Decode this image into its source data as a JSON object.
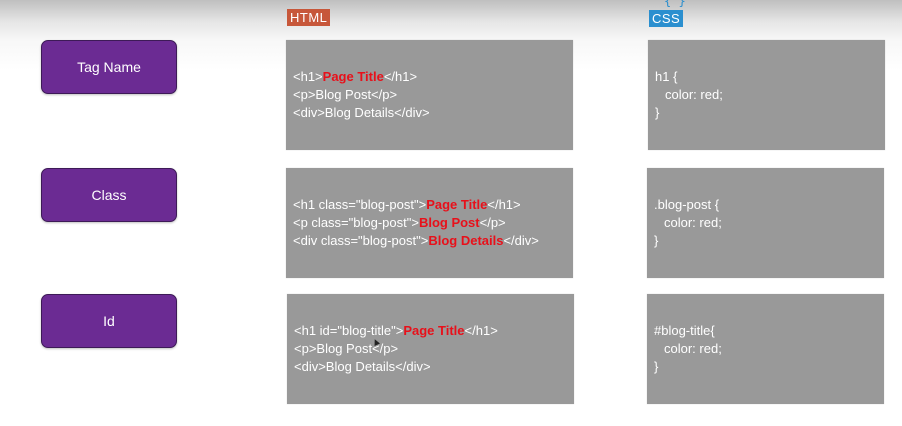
{
  "headers": {
    "html": "HTML",
    "css": "CSS",
    "css_brace": "{ }"
  },
  "selectors": [
    {
      "label": "Tag Name"
    },
    {
      "label": "Class"
    },
    {
      "label": "Id"
    }
  ],
  "rows": [
    {
      "html": [
        [
          {
            "t": "<h1>"
          },
          {
            "t": "Page Title",
            "hl": true
          },
          {
            "t": "</h1>"
          }
        ],
        [
          {
            "t": "<p>Blog Post</p>"
          }
        ],
        [
          {
            "t": "<div>Blog Details</div>"
          }
        ]
      ],
      "css": [
        [
          {
            "t": "h1 {"
          }
        ],
        [
          {
            "t": "color: red;",
            "indent": true
          }
        ],
        [
          {
            "t": "}"
          }
        ]
      ]
    },
    {
      "html": [
        [
          {
            "t": "<h1 class=\"blog-post\">"
          },
          {
            "t": "Page Title",
            "hl": true
          },
          {
            "t": "</h1>"
          }
        ],
        [
          {
            "t": "<p class=\"blog-post\">"
          },
          {
            "t": "Blog Post",
            "hl": true
          },
          {
            "t": "</p>"
          }
        ],
        [
          {
            "t": "<div class=\"blog-post\">"
          },
          {
            "t": "Blog Details",
            "hl": true
          },
          {
            "t": "</div>"
          }
        ]
      ],
      "css": [
        [
          {
            "t": ".blog-post {"
          }
        ],
        [
          {
            "t": "color: red;",
            "indent": true
          }
        ],
        [
          {
            "t": "}"
          }
        ]
      ]
    },
    {
      "html": [
        [
          {
            "t": "<h1 id=\"blog-title\">"
          },
          {
            "t": "Page Title",
            "hl": true
          },
          {
            "t": "</h1>"
          }
        ],
        [
          {
            "t": "<p>Blog Post</p>"
          }
        ],
        [
          {
            "t": "<div>Blog Details</div>"
          }
        ]
      ],
      "css": [
        [
          {
            "t": "#blog-title{"
          }
        ],
        [
          {
            "t": "color: red;",
            "indent": true
          }
        ],
        [
          {
            "t": "}"
          }
        ]
      ]
    }
  ],
  "colors": {
    "highlight": "#e8101a",
    "button_bg": "#6b2b93",
    "box_bg": "#999999",
    "html_badge": "#c7573a",
    "css_badge": "#2b8fcf"
  }
}
